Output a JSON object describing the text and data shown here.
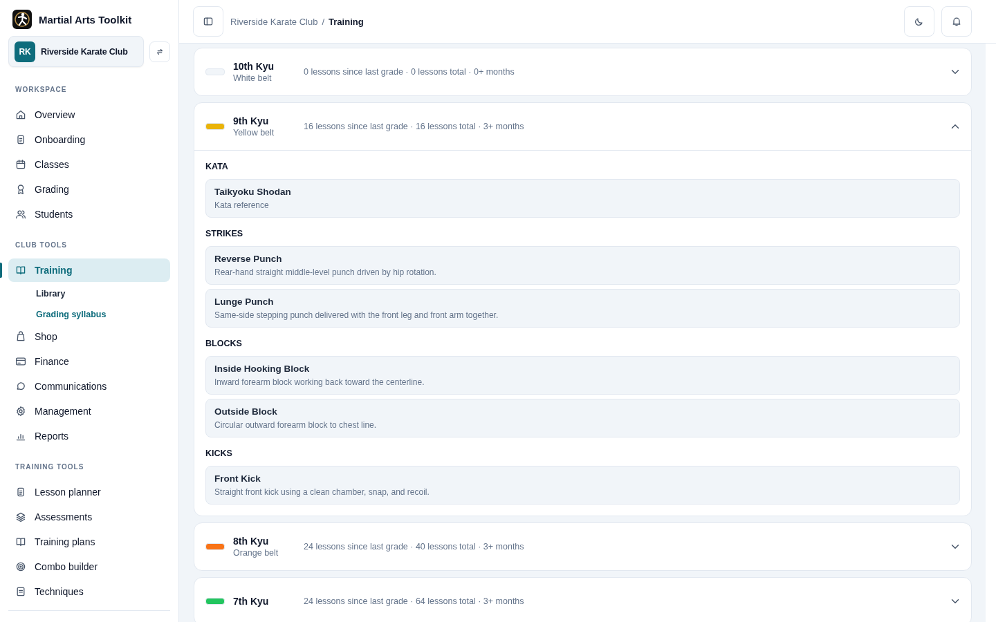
{
  "sidebar": {
    "app_name": "Martial Arts Toolkit",
    "club": {
      "initials": "RK",
      "name": "Riverside Karate Club"
    },
    "sections": [
      {
        "title": "WORKSPACE",
        "items": [
          {
            "label": "Overview",
            "selected": false
          },
          {
            "label": "Onboarding",
            "selected": false
          },
          {
            "label": "Classes",
            "selected": false
          },
          {
            "label": "Grading",
            "selected": false
          },
          {
            "label": "Students",
            "selected": false
          }
        ]
      },
      {
        "title": "CLUB TOOLS",
        "items": [
          {
            "label": "Training",
            "selected": true,
            "children": [
              {
                "label": "Library",
                "selected": false
              },
              {
                "label": "Grading syllabus",
                "selected": true
              }
            ]
          },
          {
            "label": "Shop",
            "selected": false
          },
          {
            "label": "Finance",
            "selected": false
          },
          {
            "label": "Communications",
            "selected": false
          },
          {
            "label": "Management",
            "selected": false
          },
          {
            "label": "Reports",
            "selected": false
          }
        ]
      },
      {
        "title": "TRAINING TOOLS",
        "items": [
          {
            "label": "Lesson planner",
            "selected": false
          },
          {
            "label": "Assessments",
            "selected": false
          },
          {
            "label": "Training plans",
            "selected": false
          },
          {
            "label": "Combo builder",
            "selected": false
          },
          {
            "label": "Techniques",
            "selected": false
          }
        ]
      }
    ]
  },
  "breadcrumb": {
    "parent": "Riverside Karate Club",
    "separator": "/",
    "current": "Training"
  },
  "grades": [
    {
      "title": "10th Kyu",
      "belt": "White belt",
      "meta": "0 lessons since last grade · 0 lessons total · 0+ months",
      "color": "#f1f5f9",
      "expanded": false
    },
    {
      "title": "9th Kyu",
      "belt": "Yellow belt",
      "meta": "16 lessons since last grade · 16 lessons total · 3+ months",
      "color": "#eab308",
      "expanded": true,
      "sections": [
        {
          "heading": "KATA",
          "items": [
            {
              "name": "Taikyoku Shodan",
              "description": "Kata reference"
            }
          ]
        },
        {
          "heading": "STRIKES",
          "items": [
            {
              "name": "Reverse Punch",
              "description": "Rear-hand straight middle-level punch driven by hip rotation."
            },
            {
              "name": "Lunge Punch",
              "description": "Same-side stepping punch delivered with the front leg and front arm together."
            }
          ]
        },
        {
          "heading": "BLOCKS",
          "items": [
            {
              "name": "Inside Hooking Block",
              "description": "Inward forearm block working back toward the centerline."
            },
            {
              "name": "Outside Block",
              "description": "Circular outward forearm block to chest line."
            }
          ]
        },
        {
          "heading": "KICKS",
          "items": [
            {
              "name": "Front Kick",
              "description": "Straight front kick using a clean chamber, snap, and recoil."
            }
          ]
        }
      ]
    },
    {
      "title": "8th Kyu",
      "belt": "Orange belt",
      "meta": "24 lessons since last grade · 40 lessons total · 3+ months",
      "color": "#f97316",
      "expanded": false
    },
    {
      "title": "7th Kyu",
      "meta": "24 lessons since last grade · 64 lessons total · 3+ months",
      "color": "#22c55e",
      "expanded": false
    }
  ]
}
